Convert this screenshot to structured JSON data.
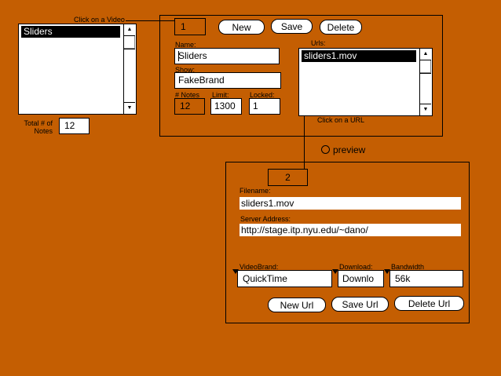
{
  "videos": {
    "hint": "Click on a Video",
    "items": [
      "Sliders"
    ],
    "total_label": "Total # of Notes",
    "total_value": "12"
  },
  "video_panel": {
    "index": "1",
    "new_label": "New",
    "save_label": "Save",
    "delete_label": "Delete",
    "name_label": "Name:",
    "name_value": "Sliders",
    "show_label": "Show:",
    "show_value": "FakeBrand",
    "notes_label": "# Notes",
    "notes_value": "12",
    "limit_label": "Limit:",
    "limit_value": "1300",
    "locked_label": "Locked:",
    "locked_value": "1",
    "urls_label": "Urls:",
    "urls": [
      "sliders1.mov"
    ],
    "urls_hint": "Click on a URL"
  },
  "preview": {
    "label": "preview"
  },
  "url_panel": {
    "index": "2",
    "filename_label": "Filename:",
    "filename_value": "sliders1.mov",
    "server_label": "Server Address:",
    "server_value": "http://stage.itp.nyu.edu/~dano/",
    "brand_label": "VideoBrand:",
    "brand_value": "QuickTime",
    "download_label": "Download:",
    "download_value": "Downlo",
    "bandwidth_label": "Bandwidth",
    "bandwidth_value": "56k",
    "new_url_label": "New Url",
    "save_url_label": "Save Url",
    "delete_url_label": "Delete Url"
  }
}
